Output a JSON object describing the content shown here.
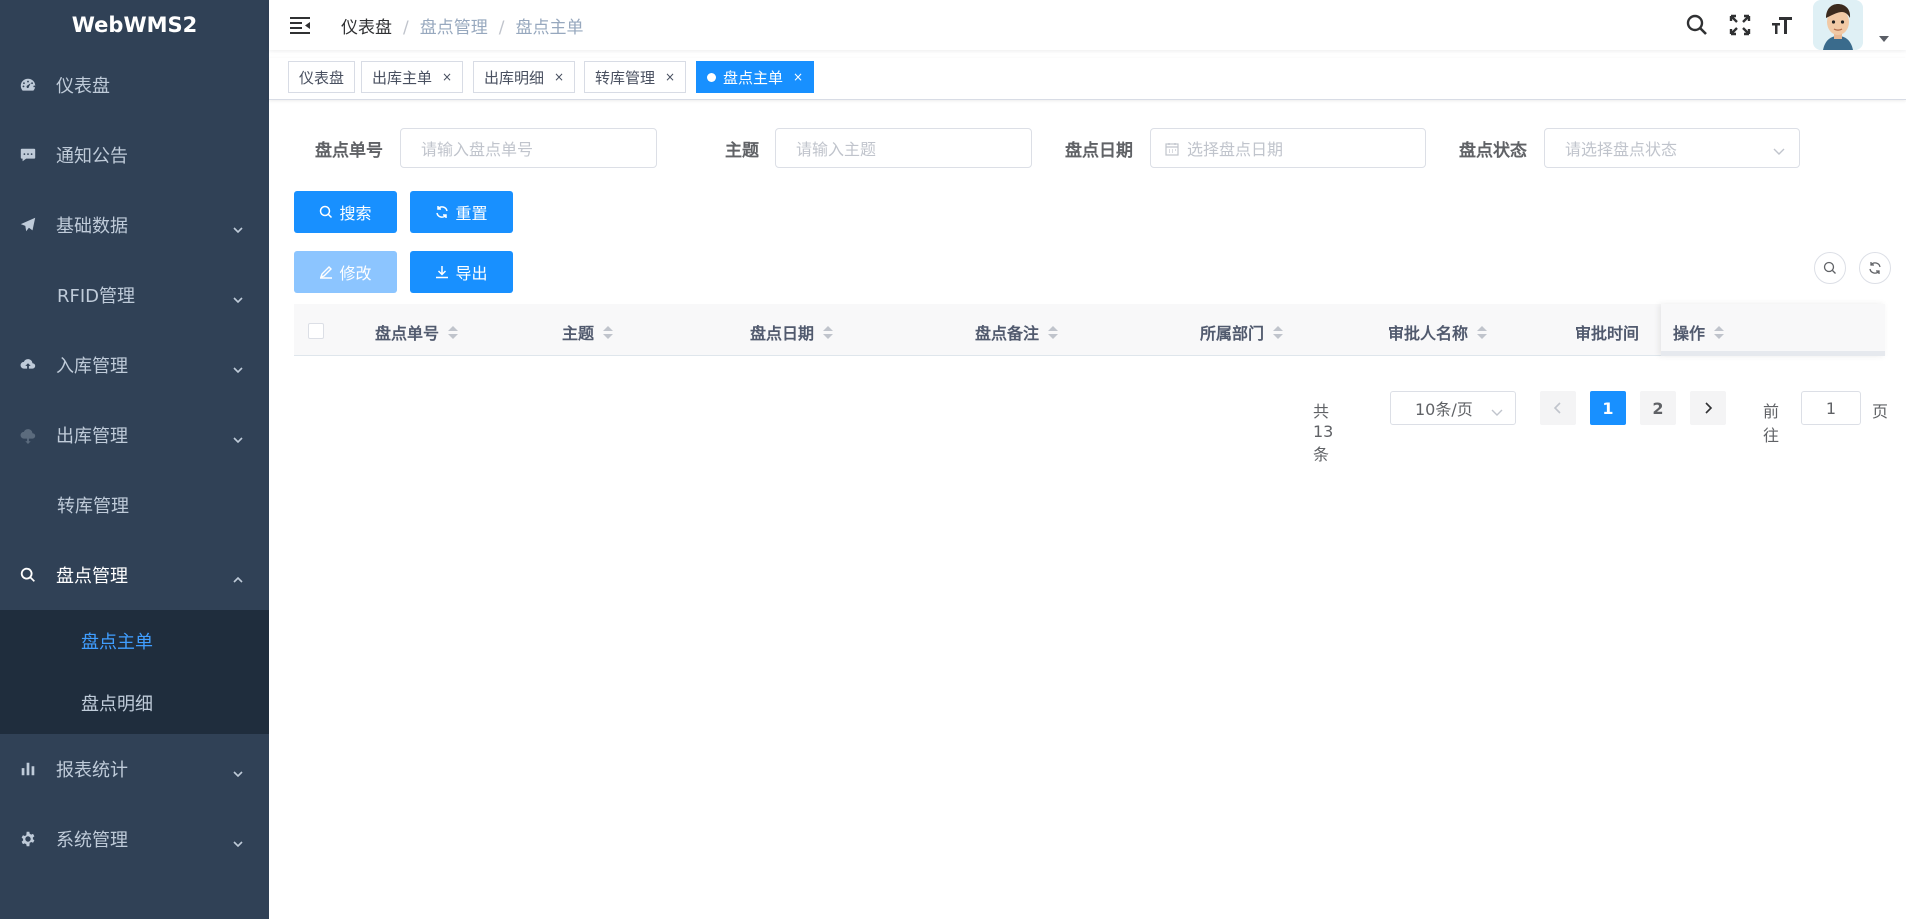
{
  "app": {
    "logo": "WebWMS2"
  },
  "sidebar": {
    "items": [
      {
        "label": "仪表盘",
        "icon": "dashboard-icon",
        "has_children": false
      },
      {
        "label": "通知公告",
        "icon": "message-icon",
        "has_children": false
      },
      {
        "label": "基础数据",
        "icon": "send-icon",
        "has_children": true
      },
      {
        "label": "RFID管理",
        "icon": "",
        "has_children": true
      },
      {
        "label": "入库管理",
        "icon": "cloud-upload-icon",
        "has_children": true
      },
      {
        "label": "出库管理",
        "icon": "cloud-download-icon",
        "has_children": true
      },
      {
        "label": "转库管理",
        "icon": "",
        "has_children": false
      },
      {
        "label": "盘点管理",
        "icon": "search-icon",
        "has_children": true,
        "open": true
      },
      {
        "label": "报表统计",
        "icon": "chart-icon",
        "has_children": true
      },
      {
        "label": "系统管理",
        "icon": "gear-icon",
        "has_children": true
      }
    ],
    "submenu": [
      {
        "label": "盘点主单",
        "active": true
      },
      {
        "label": "盘点明细",
        "active": false
      }
    ]
  },
  "breadcrumb": [
    "仪表盘",
    "盘点管理",
    "盘点主单"
  ],
  "tags": [
    {
      "label": "仪表盘",
      "closable": false,
      "active": false
    },
    {
      "label": "出库主单",
      "closable": true,
      "active": false
    },
    {
      "label": "出库明细",
      "closable": true,
      "active": false
    },
    {
      "label": "转库管理",
      "closable": true,
      "active": false
    },
    {
      "label": "盘点主单",
      "closable": true,
      "active": true
    }
  ],
  "tag_close": "×",
  "search_form": {
    "order_no": {
      "label": "盘点单号",
      "placeholder": "请输入盘点单号"
    },
    "subject": {
      "label": "主题",
      "placeholder": "请输入主题"
    },
    "date": {
      "label": "盘点日期",
      "placeholder": "选择盘点日期"
    },
    "status": {
      "label": "盘点状态",
      "placeholder": "请选择盘点状态"
    }
  },
  "buttons": {
    "search": "搜索",
    "reset": "重置",
    "edit": "修改",
    "export": "导出"
  },
  "table": {
    "columns": [
      "盘点单号",
      "主题",
      "盘点日期",
      "盘点备注",
      "所属部门",
      "审批人名称",
      "审批时间"
    ],
    "fixed_column": "操作"
  },
  "pagination": {
    "total_text": "共 13 条",
    "page_size": "10条/页",
    "pages": [
      "1",
      "2"
    ],
    "current": "1",
    "goto_label": "前往",
    "goto_value": "1",
    "page_suffix": "页"
  },
  "colors": {
    "sidebar_bg": "#304156",
    "submenu_bg": "#1f2d3d",
    "primary": "#1890ff",
    "active_text": "#409eff"
  }
}
